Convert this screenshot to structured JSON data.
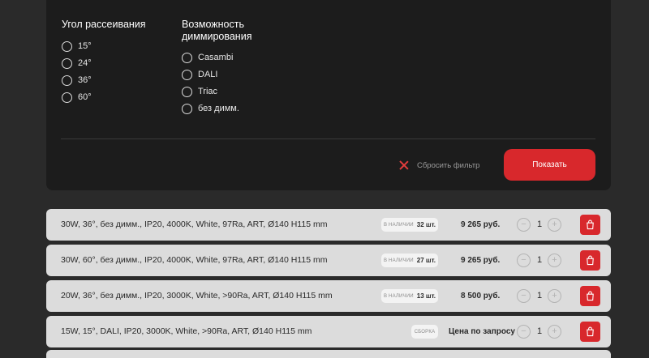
{
  "filters": {
    "angle": {
      "title": "Угол рассеивания",
      "options": [
        "15°",
        "24°",
        "36°",
        "60°"
      ]
    },
    "dimming": {
      "title_line1": "Возможность",
      "title_line2": "диммирования",
      "options": [
        "Casambi",
        "DALI",
        "Triac",
        "без димм."
      ]
    },
    "reset_label": "Сбросить фильтр",
    "show_label": "Показать"
  },
  "products": [
    {
      "name": "30W, 36°, без димм., IP20, 4000K, White, 97Ra, ART, Ø140 H115 mm",
      "stock_label": "в наличии",
      "stock_count": "32 шт.",
      "price": "9 265 руб.",
      "qty": "1"
    },
    {
      "name": "30W, 60°, без димм., IP20, 4000K, White, 97Ra, ART, Ø140 H115 mm",
      "stock_label": "в наличии",
      "stock_count": "27 шт.",
      "price": "9 265 руб.",
      "qty": "1"
    },
    {
      "name": "20W, 36°, без димм., IP20, 3000K, White, >90Ra, ART, Ø140 H115 mm",
      "stock_label": "в наличии",
      "stock_count": "13 шт.",
      "price": "8 500 руб.",
      "qty": "1"
    },
    {
      "name": "15W, 15°, DALI, IP20, 3000K, White, >90Ra, ART, Ø140 H115 mm",
      "stock_label": "сборка",
      "stock_count": "",
      "price": "Цена по запросу",
      "qty": "1"
    }
  ],
  "qty_minus": "−",
  "qty_plus": "+",
  "colors": {
    "accent": "#d8282c",
    "panel_bg": "#1c1c1c",
    "page_bg": "#2a2a2a",
    "row_bg": "#dcdcdc"
  },
  "icons": {
    "reset": "close-icon",
    "cart": "shopping-bag-icon"
  }
}
